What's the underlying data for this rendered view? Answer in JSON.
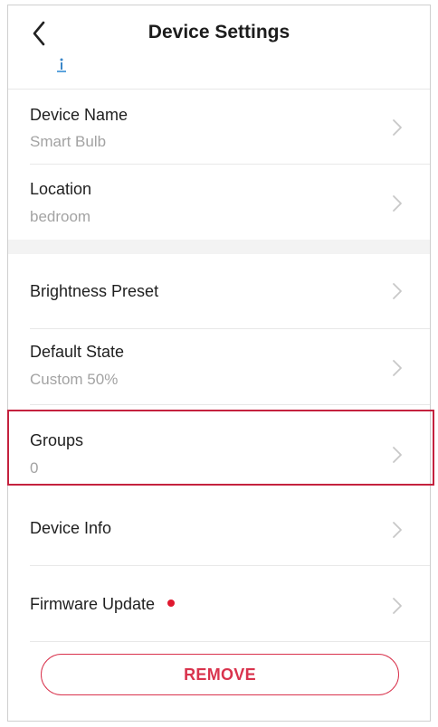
{
  "header": {
    "title": "Device Settings"
  },
  "settings": {
    "device_name": {
      "label": "Device Name",
      "value": "Smart Bulb"
    },
    "location": {
      "label": "Location",
      "value": "bedroom"
    },
    "brightness_preset": {
      "label": "Brightness Preset"
    },
    "default_state": {
      "label": "Default State",
      "value": "Custom 50%"
    },
    "groups": {
      "label": "Groups",
      "value": "0"
    },
    "device_info": {
      "label": "Device Info"
    },
    "firmware_update": {
      "label": "Firmware Update",
      "has_update_indicator": true
    }
  },
  "actions": {
    "remove_label": "REMOVE"
  },
  "colors": {
    "accent": "#d9334d",
    "indicator": "#e0182f",
    "highlight": "#c4223e"
  },
  "icons": {
    "back": "chevron-left-icon",
    "device": "device-status-icon",
    "row": "chevron-right-icon"
  }
}
